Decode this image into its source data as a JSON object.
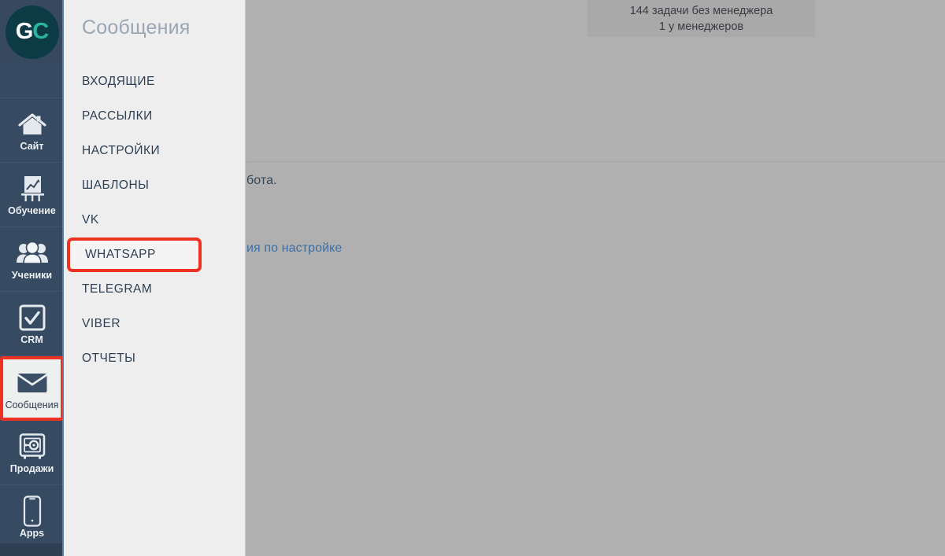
{
  "badge": {
    "name": "tasks-without-manager-badge",
    "lines": [
      "144 задачи без менеджера",
      "1 у менеджеров"
    ]
  },
  "underlay": {
    "cut_text_dark": "бота.",
    "cut_text_link": "ия по настройке"
  },
  "sidebar": {
    "logo": {
      "first": "G",
      "second": "C"
    },
    "items": [
      {
        "label": "Сайт",
        "icon": "home-icon",
        "active": false
      },
      {
        "label": "Обучение",
        "icon": "chart-easel-icon",
        "active": false
      },
      {
        "label": "Ученики",
        "icon": "users-icon",
        "active": false
      },
      {
        "label": "CRM",
        "icon": "checkbox-icon",
        "active": false
      },
      {
        "label": "Сообщения",
        "icon": "envelope-icon",
        "active": true
      },
      {
        "label": "Продажи",
        "icon": "safe-gear-icon",
        "active": false
      },
      {
        "label": "Apps",
        "icon": "phone-icon",
        "active": false
      }
    ]
  },
  "menu": {
    "title": "Сообщения",
    "items": [
      {
        "label": "ВХОДЯЩИЕ",
        "highlighted": false
      },
      {
        "label": "РАССЫЛКИ",
        "highlighted": false
      },
      {
        "label": "НАСТРОЙКИ",
        "highlighted": false
      },
      {
        "label": "ШАБЛОНЫ",
        "highlighted": false
      },
      {
        "label": "VK",
        "highlighted": false
      },
      {
        "label": "WHATSAPP",
        "highlighted": true
      },
      {
        "label": "TELEGRAM",
        "highlighted": false
      },
      {
        "label": "VIBER",
        "highlighted": false
      },
      {
        "label": "ОТЧЕТЫ",
        "highlighted": false
      }
    ]
  },
  "colors": {
    "sidebar_bg": "#364a61",
    "panel_bg": "#eeeeee",
    "highlight_red": "#ef3124",
    "link_blue": "#3c6ea5",
    "logo_teal": "#27b5a0"
  }
}
